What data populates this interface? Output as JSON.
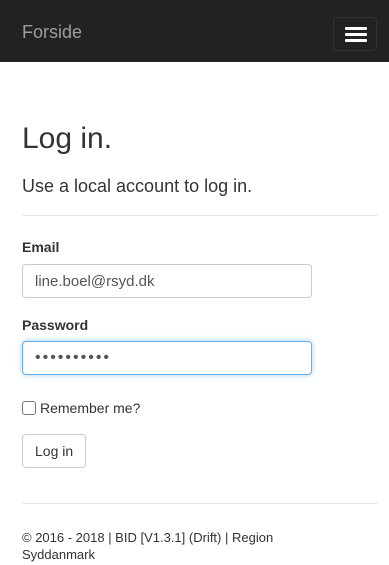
{
  "navbar": {
    "brand": "Forside",
    "menu_icon": "hamburger-menu-icon"
  },
  "main": {
    "title": "Log in.",
    "subtitle": "Use a local account to log in."
  },
  "form": {
    "email_label": "Email",
    "email_value": "line.boel@rsyd.dk",
    "password_label": "Password",
    "password_value": "••••••••••",
    "remember_label": "Remember me?",
    "remember_checked": false,
    "submit_label": "Log in"
  },
  "footer": {
    "text": "© 2016 - 2018 | BID [V1.3.1] (Drift) | Region Syddanmark"
  },
  "colors": {
    "navbar_bg": "#222222",
    "brand_text": "#9d9d9d",
    "focus_border": "#66afe9"
  }
}
